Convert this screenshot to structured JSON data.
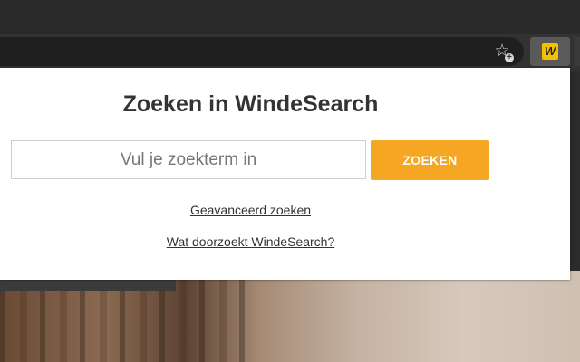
{
  "popup": {
    "title": "Zoeken in WindeSearch",
    "search_placeholder": "Vul je zoekterm in",
    "search_button_label": "ZOEKEN",
    "advanced_link": "Geavanceerd zoeken",
    "about_link": "Wat doorzoekt WindeSearch?"
  },
  "browser": {
    "extension_icon_letter": "W",
    "star_icon": "☆",
    "star_plus": "+"
  },
  "icons": {
    "bookmark": "star-add-icon",
    "extension": "windesearch-extension-icon"
  },
  "colors": {
    "accent": "#f5a623",
    "extension": "#f2c200"
  }
}
